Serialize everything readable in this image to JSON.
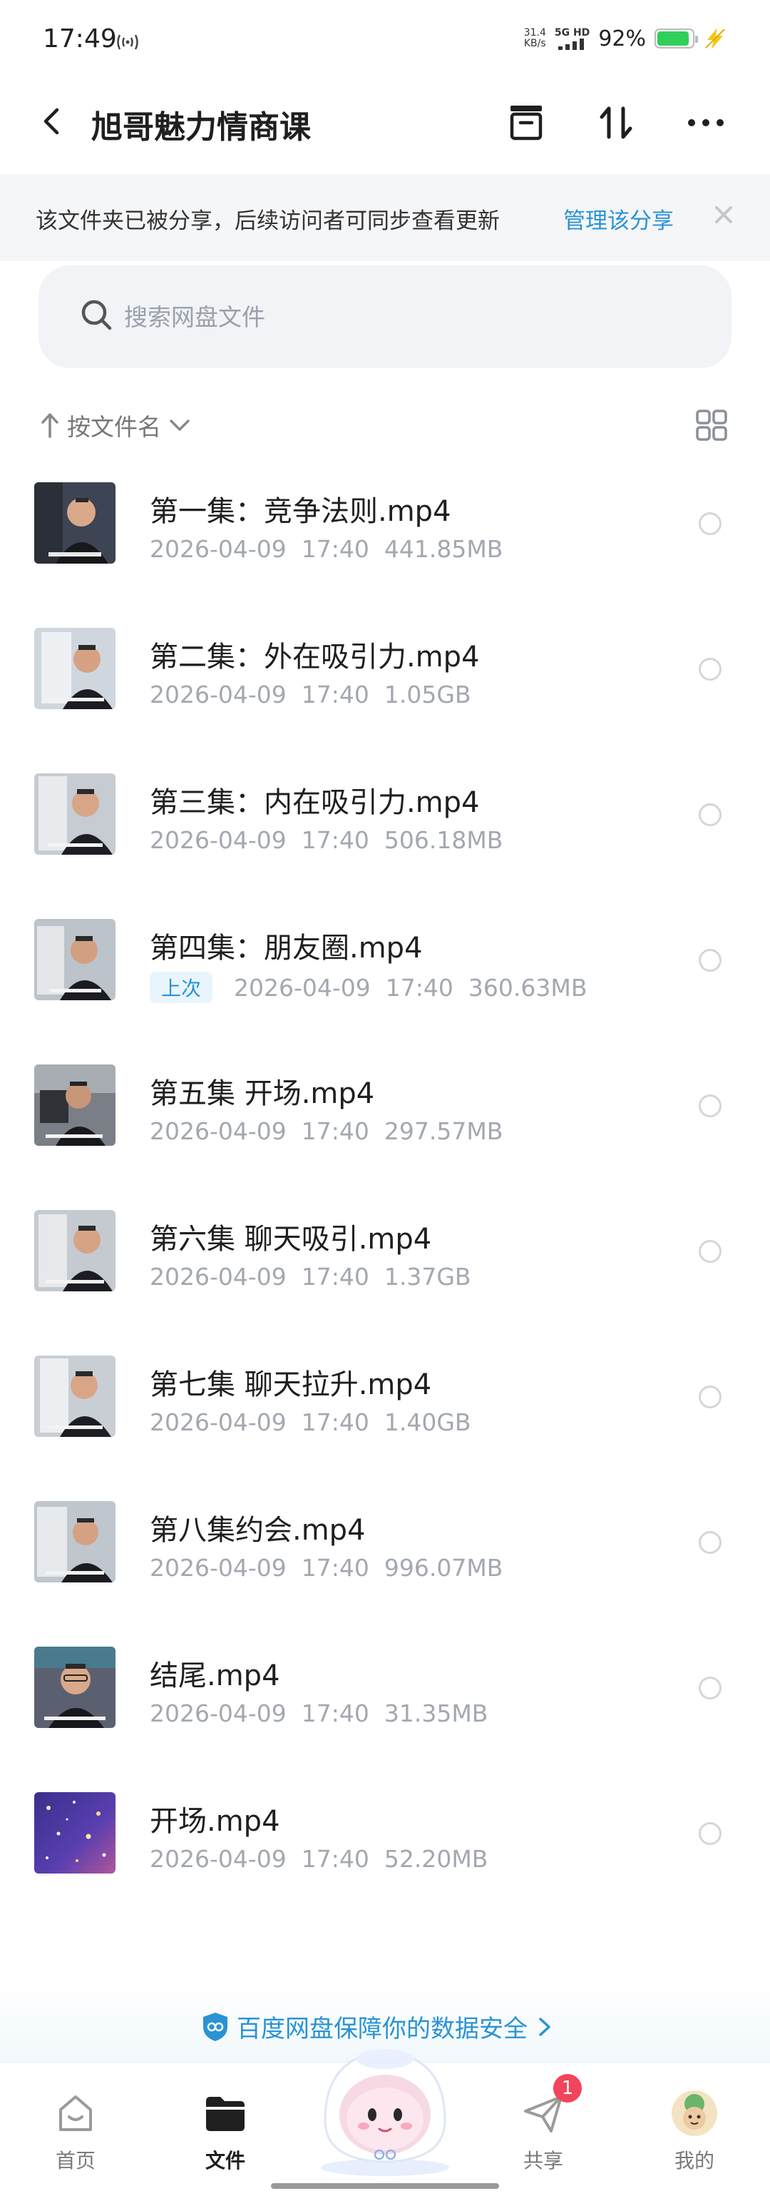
{
  "status_bar": {
    "time": "17:49",
    "net_speed_value": "31.4",
    "net_speed_unit": "KB/s",
    "network": "5G HD",
    "battery": "92%",
    "battery_level": 0.92
  },
  "header": {
    "title": "旭哥魅力情商课"
  },
  "share_banner": {
    "text": "该文件夹已被分享，后续访问者可同步查看更新",
    "link": "管理该分享"
  },
  "search": {
    "placeholder": "搜索网盘文件"
  },
  "sort": {
    "label": "按文件名"
  },
  "files": [
    {
      "name": "第一集：竞争法则.mp4",
      "date": "2026-04-09",
      "time": "17:40",
      "size": "441.85MB",
      "badge": ""
    },
    {
      "name": "第二集：外在吸引力.mp4",
      "date": "2026-04-09",
      "time": "17:40",
      "size": "1.05GB",
      "badge": ""
    },
    {
      "name": "第三集：内在吸引力.mp4",
      "date": "2026-04-09",
      "time": "17:40",
      "size": "506.18MB",
      "badge": ""
    },
    {
      "name": "第四集：朋友圈.mp4",
      "date": "2026-04-09",
      "time": "17:40",
      "size": "360.63MB",
      "badge": "上次"
    },
    {
      "name": "第五集 开场.mp4",
      "date": "2026-04-09",
      "time": "17:40",
      "size": "297.57MB",
      "badge": ""
    },
    {
      "name": "第六集 聊天吸引.mp4",
      "date": "2026-04-09",
      "time": "17:40",
      "size": "1.37GB",
      "badge": ""
    },
    {
      "name": "第七集 聊天拉升.mp4",
      "date": "2026-04-09",
      "time": "17:40",
      "size": "1.40GB",
      "badge": ""
    },
    {
      "name": "第八集约会.mp4",
      "date": "2026-04-09",
      "time": "17:40",
      "size": "996.07MB",
      "badge": ""
    },
    {
      "name": "结尾.mp4",
      "date": "2026-04-09",
      "time": "17:40",
      "size": "31.35MB",
      "badge": ""
    },
    {
      "name": "开场.mp4",
      "date": "2026-04-09",
      "time": "17:40",
      "size": "52.20MB",
      "badge": ""
    }
  ],
  "safety": {
    "text": "百度网盘保障你的数据安全"
  },
  "nav": {
    "home": "首页",
    "files": "文件",
    "share": "共享",
    "share_badge": "1",
    "me": "我的"
  },
  "colors": {
    "accent": "#2a93d5",
    "badge_red": "#f0455a",
    "battery_green": "#2fd05a",
    "banner_bg": "#f5f6f8",
    "search_bg": "#f1f3f7"
  },
  "icons": {
    "back": "back-arrow-icon",
    "archive": "archive-icon",
    "sort": "sort-arrows-icon",
    "more": "more-dots-icon",
    "close": "close-icon",
    "search": "search-icon",
    "grid": "grid-view-icon",
    "shield": "shield-icon",
    "home": "home-icon",
    "folder": "folder-icon",
    "send": "send-icon",
    "avatar": "avatar-icon"
  }
}
